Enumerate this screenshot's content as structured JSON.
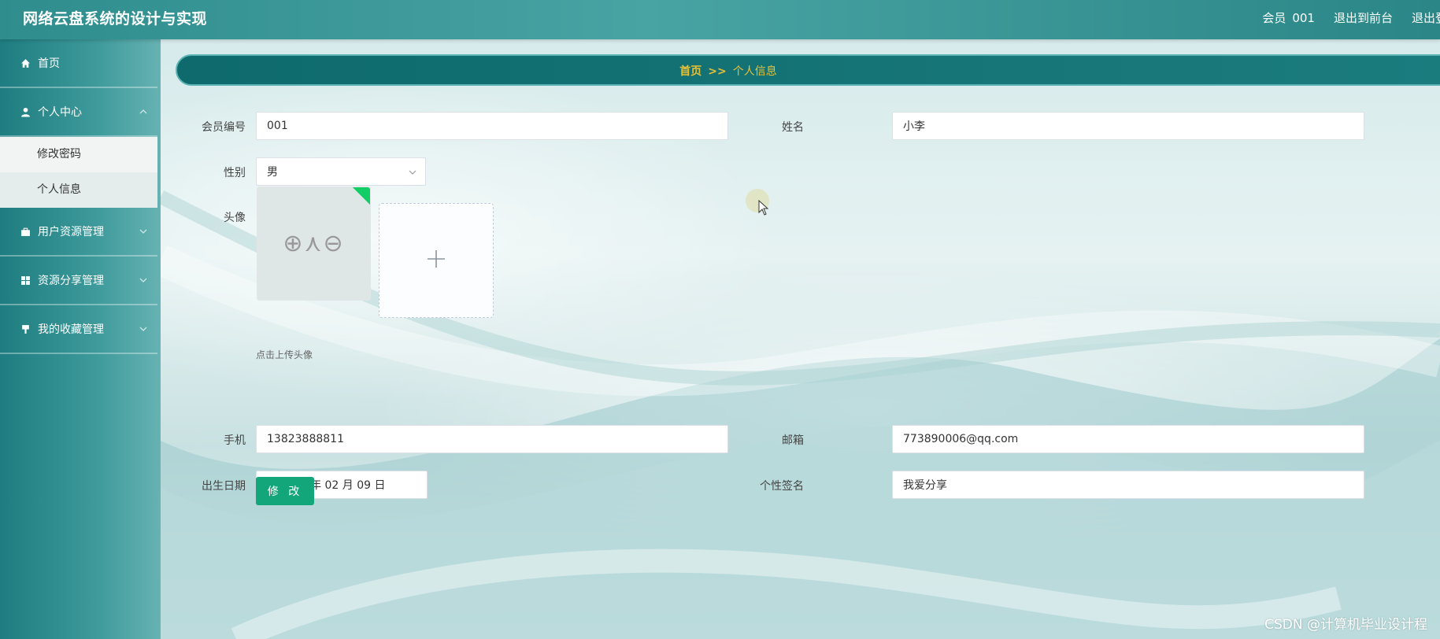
{
  "header": {
    "title": "网络云盘系统的设计与实现",
    "member_label": "会员",
    "member_value": "001",
    "to_front": "退出到前台",
    "logout": "退出登录"
  },
  "sidebar": {
    "items": [
      {
        "label": "首页",
        "icon": "home-icon"
      },
      {
        "label": "个人中心",
        "icon": "user-icon",
        "sub": [
          "修改密码",
          "个人信息"
        ]
      },
      {
        "label": "用户资源管理",
        "icon": "briefcase-icon"
      },
      {
        "label": "资源分享管理",
        "icon": "grid-icon"
      },
      {
        "label": "我的收藏管理",
        "icon": "pin-icon"
      }
    ]
  },
  "breadcrumb": {
    "home": "首页",
    "separator": ">>",
    "current": "个人信息"
  },
  "form": {
    "member_no": {
      "label": "会员编号",
      "value": "001"
    },
    "name": {
      "label": "姓名",
      "value": "小李"
    },
    "gender": {
      "label": "性别",
      "value": "男"
    },
    "avatar": {
      "label": "头像",
      "tip": "点击上传头像",
      "glyphs": "⊕⋏⊖",
      "plus": "+"
    },
    "phone": {
      "label": "手机",
      "value": "13823888811"
    },
    "email": {
      "label": "邮箱",
      "value": "773890006@qq.com"
    },
    "birthday": {
      "label": "出生日期",
      "value": "2022 年 02 月 09 日"
    },
    "signature": {
      "label": "个性签名",
      "value": "我爱分享"
    },
    "submit": "修 改"
  },
  "watermark": "CSDN @计算机毕业设计程",
  "colors": {
    "header": "#3a9798",
    "breadcrumb_bg": "#0e6a6c",
    "breadcrumb_text": "#e5c13a",
    "button": "#13a67a"
  }
}
